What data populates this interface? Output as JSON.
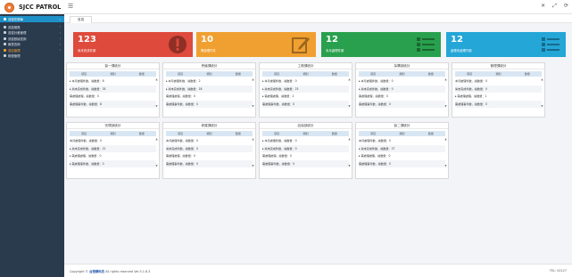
{
  "header": {
    "app_title": "SJCC PATROL",
    "menu_icon": "hamburger-icon",
    "icons": [
      "close-icon",
      "expand-icon",
      "refresh-icon"
    ]
  },
  "sidebar": {
    "items": [
      {
        "label": "巡檢任務單",
        "active": true
      },
      {
        "label": "巡檢總覽"
      },
      {
        "label": "巡檢計畫管理"
      },
      {
        "label": "巡檢數據查詢"
      },
      {
        "label": "報表查詢"
      },
      {
        "label": "項目管理",
        "accent": true
      },
      {
        "label": "帳號管理"
      }
    ]
  },
  "tabs": [
    {
      "label": "首頁"
    }
  ],
  "stats": [
    {
      "value": "123",
      "label": "尚未完成件數",
      "color": "#de4a3b",
      "icon": "alert-icon"
    },
    {
      "value": "10",
      "label": "需處理件件",
      "color": "#f0a031",
      "icon": "edit-icon"
    },
    {
      "value": "12",
      "label": "本月處理件數",
      "color": "#29a04d",
      "icon": "list-icon"
    },
    {
      "value": "12",
      "label": "處理未處理件數",
      "color": "#24a6d6",
      "icon": "list-icon"
    }
  ],
  "panel_columns": [
    "項目",
    "類別",
    "數量"
  ],
  "panels": [
    {
      "title": "製一課統計",
      "rows": [
        "▸ 本月處理件數，總數量：8",
        "▸ 尚未完成件數，總數量：35",
        "需處理處理，總數量：0",
        "需處理事件數，總數量：8"
      ]
    },
    {
      "title": "會議課統計",
      "rows": [
        "▸ 本月處理件數，總數量：2",
        "▸ 尚未完成件數，總數量：18",
        "需處理處理，總數量：0",
        "需處理事件數，總數量：0"
      ]
    },
    {
      "title": "工務課統計",
      "rows": [
        "▸ 本月處理件數，總數量：0",
        "▸ 尚未完成件數，總數量：23",
        "▸ 需處理處理，總數量：2",
        "需處理事件數，總數量：0"
      ]
    },
    {
      "title": "採購部統計",
      "rows": [
        "▸ 本月處理件數，總數量：0",
        "▸ 尚未完成件數，總數量：0",
        "需處理處理，總數量：0",
        "需處理事件數，總數量：0"
      ]
    },
    {
      "title": "管理課統計",
      "rows": [
        "本月處理件數，總數量：0",
        "尚未完成件數，總數量：0",
        "▸ 需處理處理，總數量：1",
        "需處理事件數，總數量：0"
      ]
    },
    {
      "title": "安環部統計",
      "rows": [
        "本月處理件數，總數量：0",
        "▸ 尚未完成件數，總數量：12",
        "▸ 需處理處理，總數量：0",
        "▸ 需處理事件數，總數量：0"
      ]
    },
    {
      "title": "修護課統計",
      "rows": [
        "本月處理件數，總數量：0",
        "尚未完成件數，總數量：0",
        "需處理處理，總數量：0",
        "需處理事件數，總數量：0"
      ]
    },
    {
      "title": "品保部統計",
      "rows": [
        "▸ 本月處理件數，總數量：0",
        "▸ 尚未完成件數，總數量：0",
        "需處理處理，總數量：0",
        "需處理事件數，總數量：0"
      ]
    },
    {
      "title": "製二課統計",
      "rows": [
        "本月處理件數，總數量：0",
        "▸ 尚未完成件數，總數量：27",
        "▸ 需處理處理，總數量：0",
        "需處理事件數，總數量：0"
      ]
    }
  ],
  "footer": {
    "copyright_prefix": "Copyright © ",
    "company": "台塑網科技",
    "copyright_suffix": " All rights reserved Ver.5.1.6.3",
    "tel": "TEL: 02127"
  }
}
